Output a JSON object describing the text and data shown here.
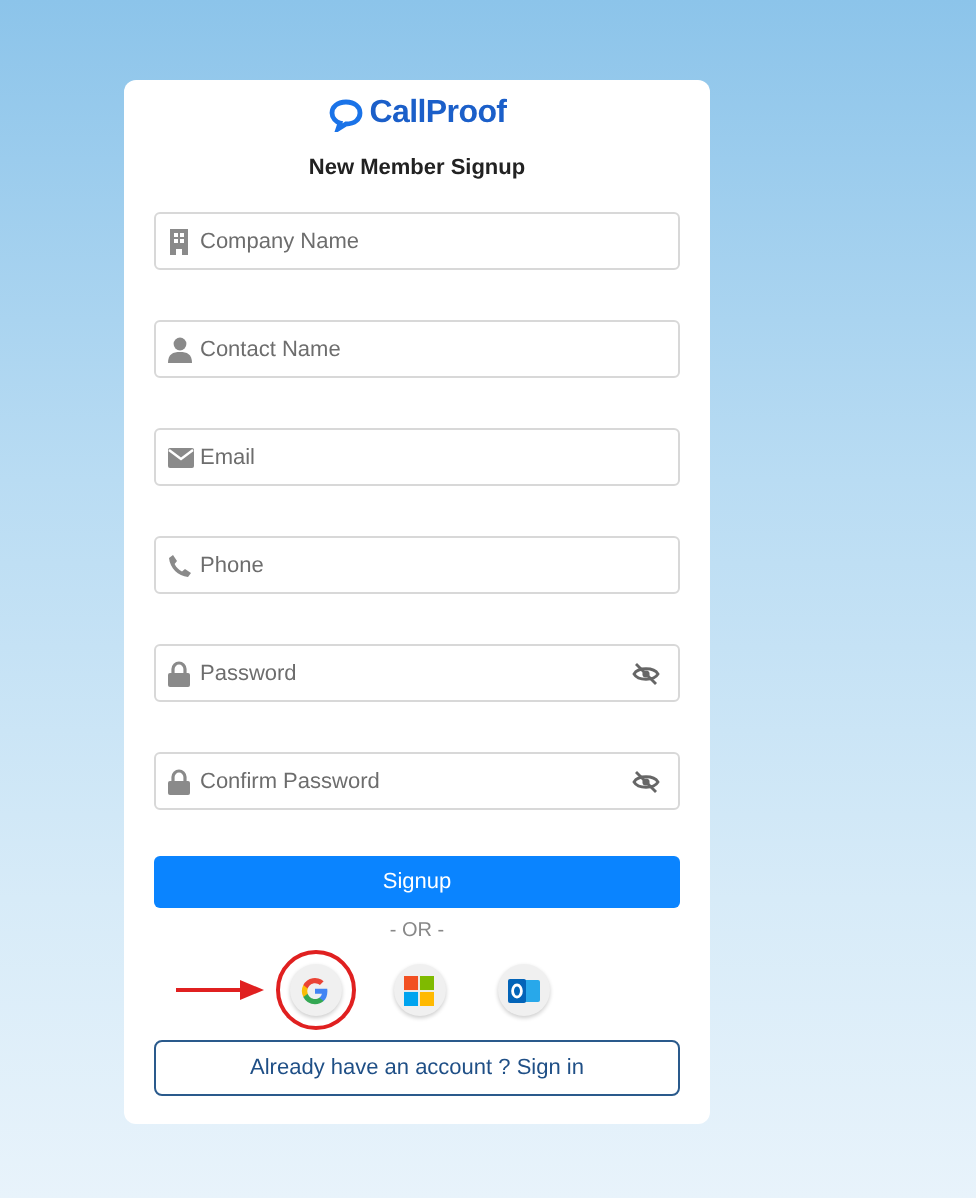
{
  "brand": "CallProof",
  "title": "New Member Signup",
  "fields": [
    {
      "placeholder": "Company Name",
      "kind": "text"
    },
    {
      "placeholder": "Contact Name",
      "kind": "text"
    },
    {
      "placeholder": "Email",
      "kind": "text"
    },
    {
      "placeholder": "Phone",
      "kind": "text"
    },
    {
      "placeholder": "Password",
      "kind": "password"
    },
    {
      "placeholder": "Confirm Password",
      "kind": "password"
    }
  ],
  "submit": "Signup",
  "separator": "- OR -",
  "social": [
    {
      "highlighted": true
    },
    {
      "highlighted": false
    },
    {
      "highlighted": false
    }
  ],
  "signin": "Already have an account ? Sign in"
}
